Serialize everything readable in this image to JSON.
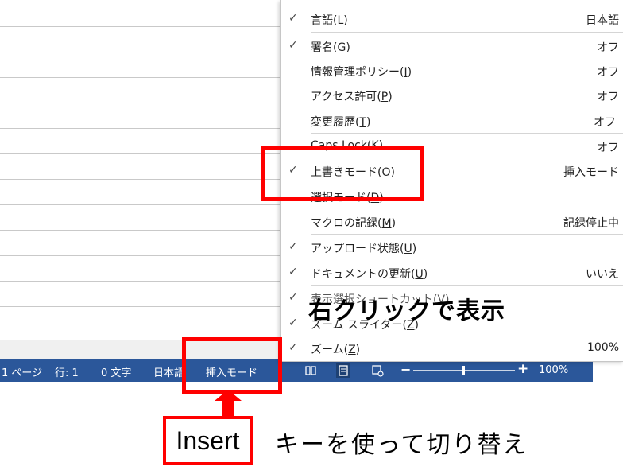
{
  "menu": {
    "items": [
      {
        "checked": true,
        "label": "言語",
        "key": "L",
        "value": "日本語"
      },
      {
        "checked": true,
        "label": "署名",
        "key": "G",
        "value": "オフ"
      },
      {
        "checked": false,
        "label": "情報管理ポリシー",
        "key": "I",
        "value": "オフ"
      },
      {
        "checked": false,
        "label": "アクセス許可",
        "key": "P",
        "value": "オフ"
      },
      {
        "checked": false,
        "label": "変更履歴",
        "key": "T",
        "value": "オフ"
      },
      {
        "checked": false,
        "label": "Caps Lock",
        "key": "K",
        "value": "オフ"
      },
      {
        "checked": true,
        "label": "上書きモード",
        "key": "O",
        "value": "挿入モード"
      },
      {
        "checked": false,
        "label": "選択モード",
        "key": "D",
        "value": ""
      },
      {
        "checked": false,
        "label": "マクロの記録",
        "key": "M",
        "value": "記録停止中"
      },
      {
        "checked": true,
        "label": "アップロード状態",
        "key": "U",
        "value": ""
      },
      {
        "checked": true,
        "label": "ドキュメントの更新",
        "key": "U",
        "value": "いいえ"
      },
      {
        "checked": true,
        "label": "表示選択ショートカット",
        "key": "V",
        "value": ""
      },
      {
        "checked": true,
        "label": "ズーム スライダー",
        "key": "Z",
        "value": ""
      },
      {
        "checked": true,
        "label": "ズーム",
        "key": "Z",
        "value": "100%"
      }
    ]
  },
  "statusbar": {
    "page": "1 ページ",
    "row": "行: 1",
    "chars": "0 文字",
    "language": "日本語",
    "mode": "挿入モード",
    "zoom_minus": "−",
    "zoom_plus": "+",
    "zoom": "100%",
    "zoom_level": 0.5
  },
  "annotations": {
    "right_click_caption": "右クリックで表示",
    "insert_key": "Insert",
    "insert_caption": "キーを使って切り替え"
  },
  "colors": {
    "statusbar": "#2b579a",
    "highlight": "#ff0000"
  }
}
